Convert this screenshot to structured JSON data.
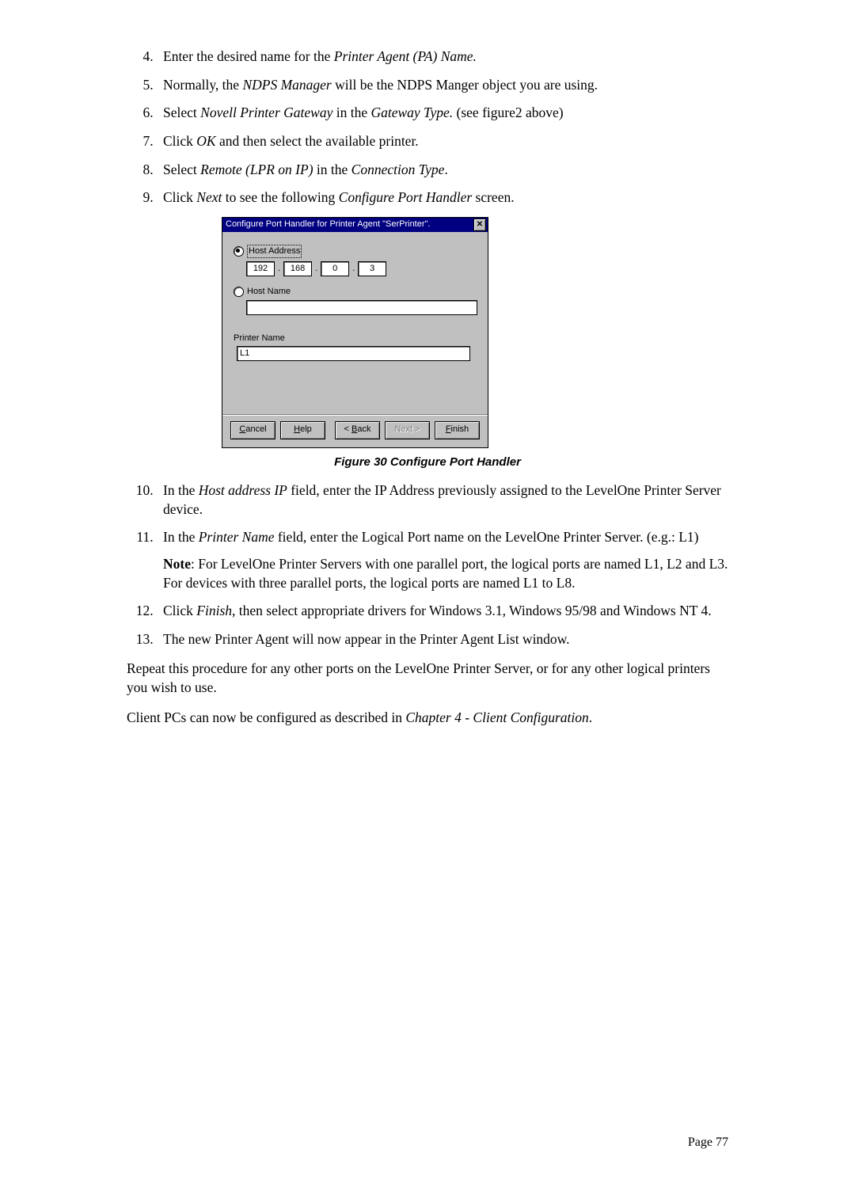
{
  "list1": {
    "item4": [
      "Enter the desired name for the ",
      "Printer Agent (PA) Name.",
      ""
    ],
    "item5": [
      "Normally, the ",
      "NDPS Manager",
      " will be the NDPS Manger object you are using."
    ],
    "item6": [
      "Select ",
      "Novell Printer Gateway",
      " in the ",
      "Gateway Type.",
      " (see figure2 above)"
    ],
    "item7": [
      "Click ",
      "OK",
      " and then select the available printer."
    ],
    "item8": [
      "Select ",
      "Remote (LPR on IP)",
      " in the ",
      "Connection Type",
      "."
    ],
    "item9": [
      "Click ",
      "Next",
      " to see the following ",
      "Configure Port Handler",
      " screen."
    ]
  },
  "dialog": {
    "title": "Configure Port Handler for Printer Agent \"SerPrinter\".",
    "host_address_label": "Host Address",
    "ip": [
      "192",
      "168",
      "0",
      "3"
    ],
    "host_name_label": "Host Name",
    "printer_name_label": "Printer Name",
    "printer_name_value": "L1",
    "buttons": {
      "cancel": "Cancel",
      "help": "Help",
      "back": "< Back",
      "next": "Next >",
      "finish": "Finish"
    }
  },
  "caption": "Figure 30 Configure Port Handler",
  "list2": {
    "item10": [
      "In the ",
      "Host address IP",
      " field, enter the IP Address previously assigned to the LevelOne Printer Server device."
    ],
    "item11": [
      "In the ",
      "Printer Name",
      " field, enter the Logical Port name on the LevelOne Printer Server. (e.g.: L1)"
    ],
    "note": [
      "Note",
      ": For LevelOne Printer Servers with one parallel port, the logical ports are named L1, L2 and L3. For devices with three parallel ports, the logical ports are named L1 to L8."
    ],
    "item12": [
      "Click ",
      "Finish",
      ", then select appropriate drivers for Windows 3.1, Windows 95/98 and Windows NT 4."
    ],
    "item13": "The new Printer Agent will now appear in the Printer Agent List window."
  },
  "para1": "Repeat this procedure for any other ports on the LevelOne Printer Server, or for any other logical printers you wish to use.",
  "para2": [
    "Client PCs can now be configured as described in ",
    "Chapter 4 - Client Configuration",
    "."
  ],
  "footer": "Page 77"
}
